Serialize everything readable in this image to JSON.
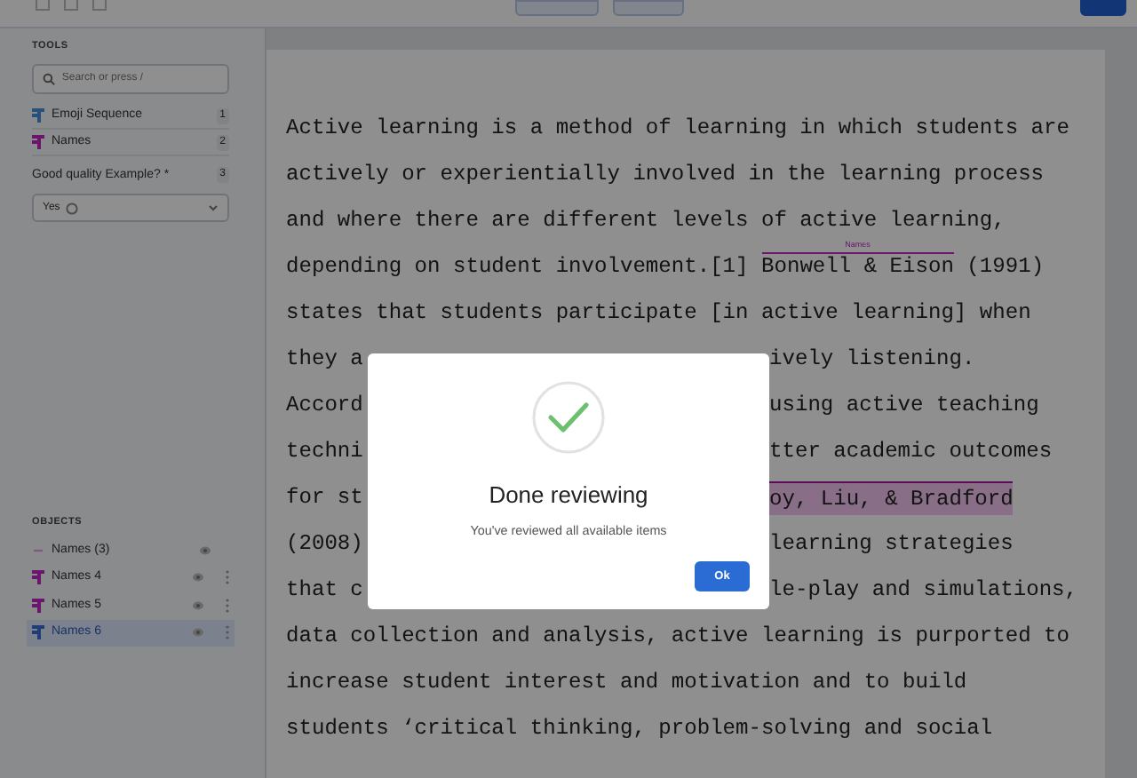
{
  "sidebar": {
    "tools_heading": "TOOLS",
    "search": {
      "placeholder": "Search or press /"
    },
    "tools": [
      {
        "label": "Emoji Sequence",
        "count": "1",
        "color": "#29507a"
      },
      {
        "label": "Names",
        "count": "2",
        "color": "#6b156b"
      }
    ],
    "question": {
      "label": "Good quality Example? *",
      "count": "3",
      "answer": "Yes"
    },
    "objects_heading": "OBJECTS",
    "objects": [
      {
        "label": "Names (3)",
        "selected": false,
        "kind": "group"
      },
      {
        "label": "Names 4",
        "selected": false,
        "kind": "item",
        "color": "#6b156b"
      },
      {
        "label": "Names 5",
        "selected": false,
        "kind": "item",
        "color": "#6b156b"
      },
      {
        "label": "Names 6",
        "selected": true,
        "kind": "item",
        "color": "#203e74"
      }
    ]
  },
  "document": {
    "lines": [
      {
        "kind": "full",
        "segments": [
          {
            "text": "Active learning is a method of learning in which students are"
          }
        ]
      },
      {
        "kind": "full",
        "segments": [
          {
            "text": "actively or experientially involved in the learning process"
          }
        ]
      },
      {
        "kind": "full",
        "segments": [
          {
            "text": "and where there are different levels of active learning,"
          }
        ]
      },
      {
        "kind": "full",
        "segments": [
          {
            "text": "depending on student involvement.[1] "
          },
          {
            "text": "Bonwell & Eison",
            "kind": "annotation",
            "label": "Names"
          },
          {
            "text": " (1991)"
          }
        ]
      },
      {
        "kind": "full",
        "segments": [
          {
            "text": "states that students participate [in active learning] when"
          }
        ]
      },
      {
        "kind": "split",
        "left": "they a",
        "right": [
          {
            "text": "ively listening."
          }
        ]
      },
      {
        "kind": "split",
        "left": "Accord",
        "right": [
          {
            "text": "using active teaching"
          }
        ]
      },
      {
        "kind": "split",
        "left": "techni",
        "right": [
          {
            "text": "tter academic outcomes"
          }
        ]
      },
      {
        "kind": "split",
        "left": "for st",
        "right": [
          {
            "text": "oy, Liu, & Bradford",
            "kind": "highlight"
          }
        ]
      },
      {
        "kind": "split",
        "left": "(2008)",
        "right": [
          {
            "text": "learning strategies"
          }
        ]
      },
      {
        "kind": "split",
        "left": "that c",
        "right": [
          {
            "text": "le-play and simulations,"
          }
        ]
      },
      {
        "kind": "full",
        "segments": [
          {
            "text": "data collection and analysis, active learning is purported to"
          }
        ]
      },
      {
        "kind": "full",
        "segments": [
          {
            "text": "increase student interest and motivation and to build"
          }
        ]
      },
      {
        "kind": "full",
        "segments": [
          {
            "text": "students ‘critical thinking, problem-solving and social"
          }
        ]
      }
    ]
  },
  "dialog": {
    "title": "Done reviewing",
    "message": "You've reviewed all available items",
    "button": "Ok"
  }
}
